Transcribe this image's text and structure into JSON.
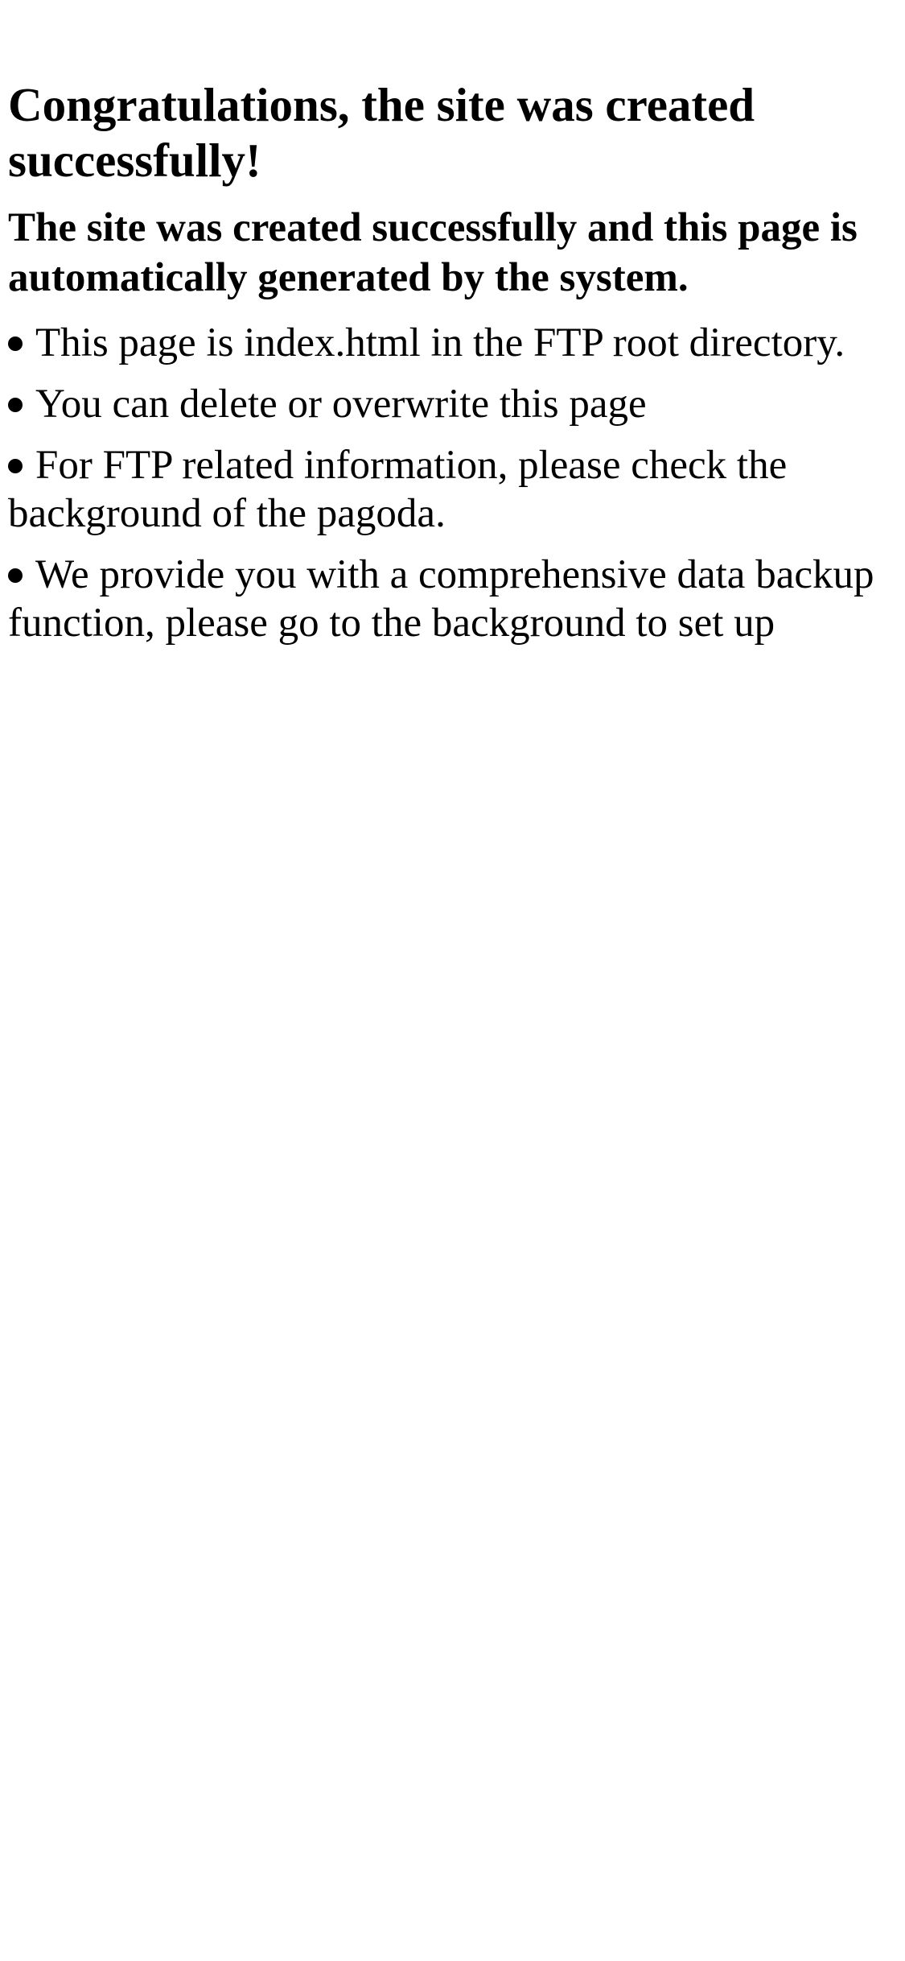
{
  "content": {
    "title": "Congratulations, the site was created successfully!",
    "subtitle": "The site was created successfully and this page is automatically generated by the system.",
    "items": [
      "This page is index.html in the FTP root directory.",
      "You can delete or overwrite this page",
      "For FTP related information, please check the background of the pagoda.",
      "We provide you with a comprehensive data backup function, please go to the background to set up"
    ]
  },
  "colors": {
    "background": "#ffffff",
    "text": "#000000"
  }
}
